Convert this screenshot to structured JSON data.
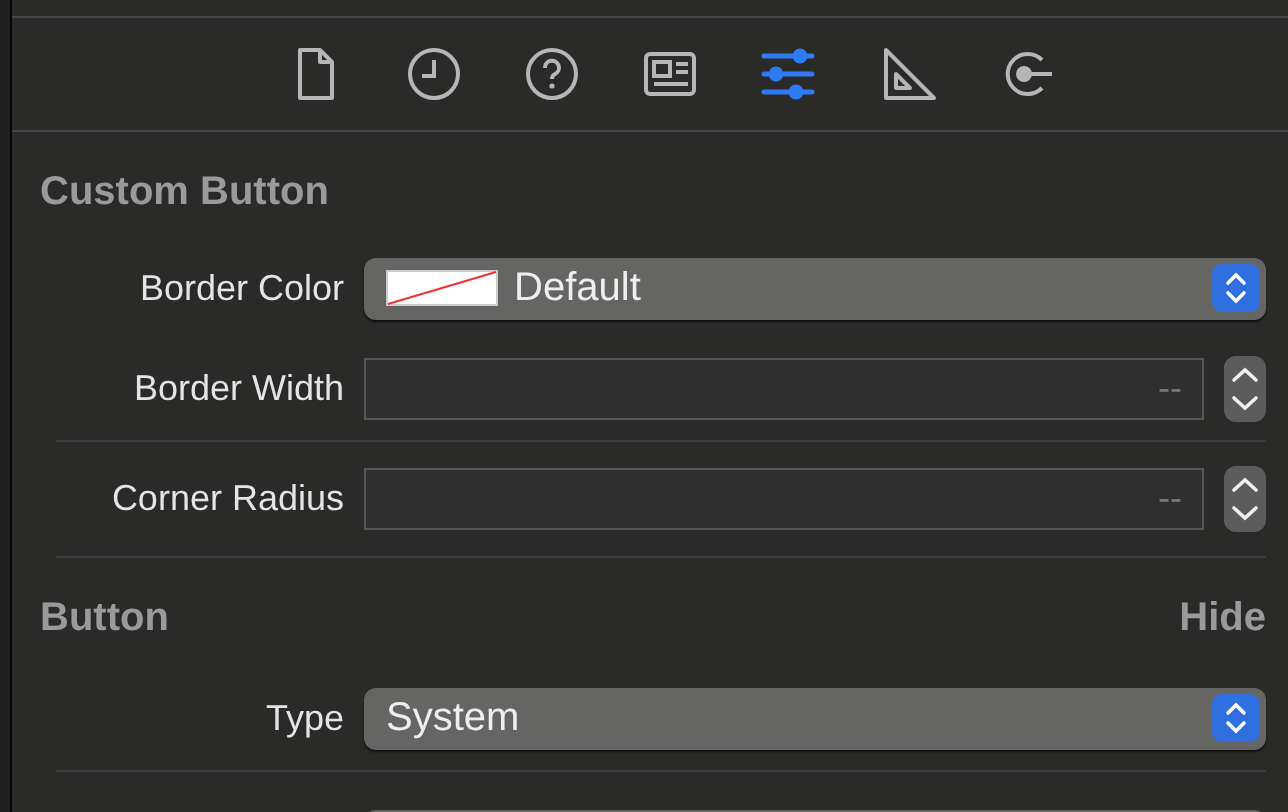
{
  "toolbar": {
    "tabs": [
      {
        "kind": "file",
        "selected": false
      },
      {
        "kind": "clock",
        "selected": false
      },
      {
        "kind": "help",
        "selected": false
      },
      {
        "kind": "panel",
        "selected": false
      },
      {
        "kind": "sliders",
        "selected": true
      },
      {
        "kind": "ruler",
        "selected": false
      },
      {
        "kind": "connection",
        "selected": false
      }
    ]
  },
  "sections": [
    {
      "title": "Custom Button",
      "rows": [
        {
          "kind": "color_popup",
          "label": "Border Color",
          "value": "Default"
        },
        {
          "kind": "stepper",
          "label": "Border Width",
          "placeholder": "--"
        },
        {
          "kind": "stepper",
          "label": "Corner Radius",
          "placeholder": "--"
        }
      ]
    },
    {
      "title": "Button",
      "action": "Hide",
      "rows": [
        {
          "kind": "popup",
          "label": "Type",
          "value": "System"
        },
        {
          "kind": "cut_popup"
        }
      ]
    }
  ]
}
